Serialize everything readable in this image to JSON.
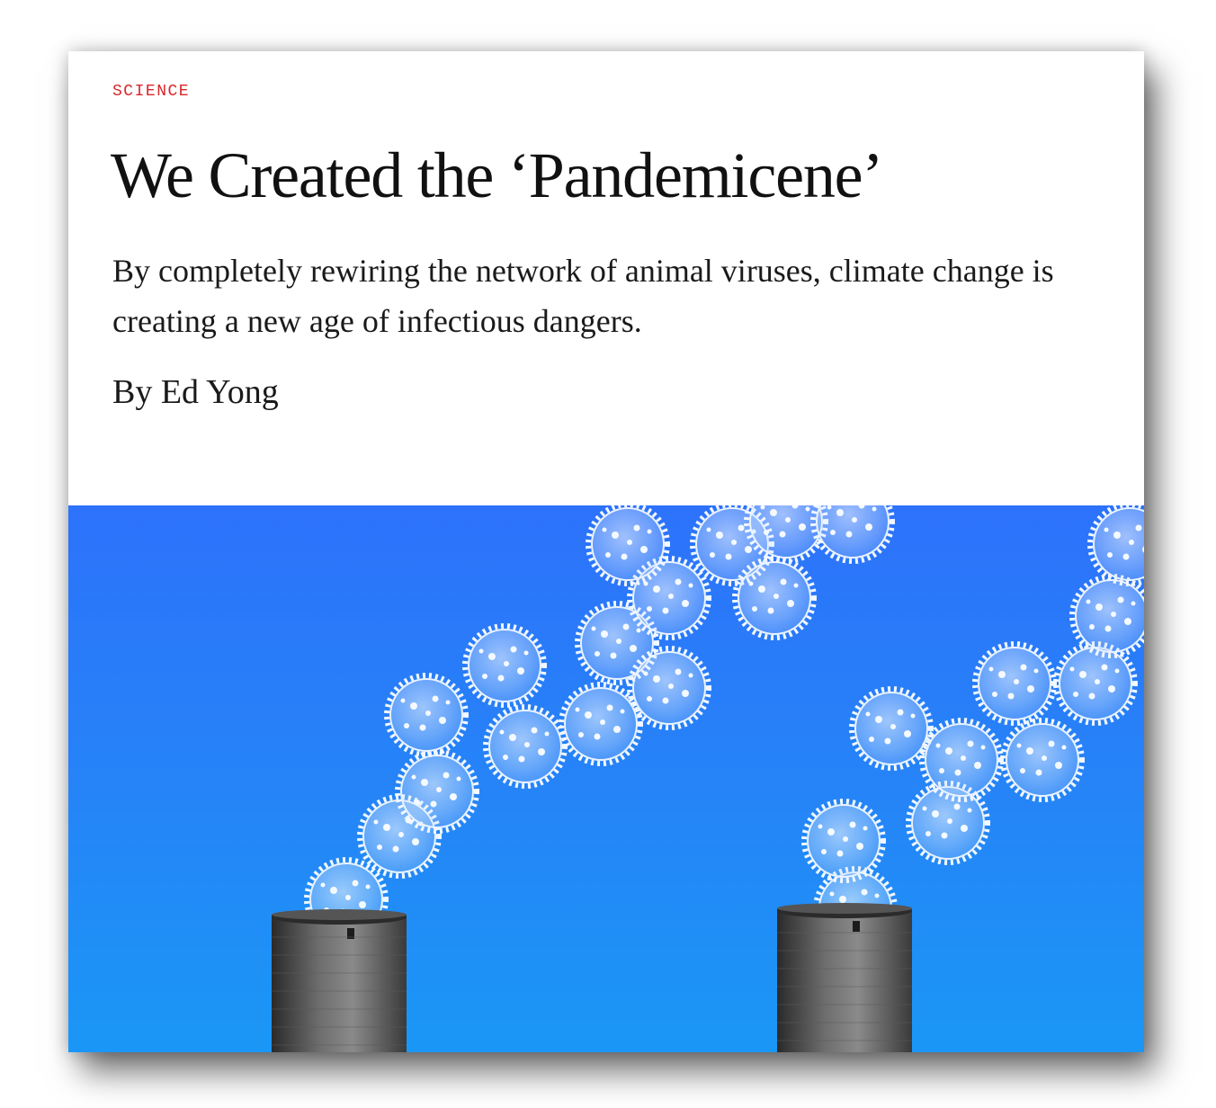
{
  "article": {
    "section": "SCIENCE",
    "title": "We Created the ‘Pandemicene’",
    "dek": "By completely rewiring the network of animal viruses, climate change is creating a new age of infectious dangers.",
    "byline": "By Ed Yong"
  },
  "hero_image": {
    "background_color": "#2d72fb",
    "virus_color": "#cfe3ff",
    "stack_color": "#4a4a4a"
  }
}
